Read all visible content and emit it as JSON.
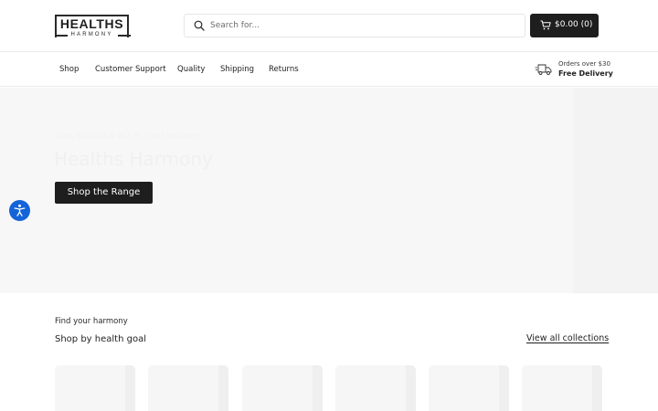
{
  "header": {
    "logo_top": "HEALTHS",
    "logo_bottom": "HARMONY",
    "search_placeholder": "Search for...",
    "cart_label": "$0.00 (0)"
  },
  "nav": {
    "items": [
      "Shop",
      "Customer Support",
      "Quality",
      "Shipping",
      "Returns"
    ],
    "delivery_line1": "Orders over $30",
    "delivery_line2": "Free Delivery"
  },
  "hero": {
    "eyebrow": "Live, sustain & act in good wellness",
    "title": "Healths Harmony",
    "button_label": "Shop the Range"
  },
  "collections": {
    "eyebrow": "Find your harmony",
    "title": "Shop by health goal",
    "view_all_label": "View all collections",
    "card_count": 6
  },
  "colors": {
    "primary_button": "#1e1e1e",
    "accessibility_button": "#1463d8",
    "hero_background": "#f7f7f7"
  },
  "icons": [
    "search-icon",
    "cart-icon",
    "truck-icon",
    "accessibility-icon"
  ]
}
